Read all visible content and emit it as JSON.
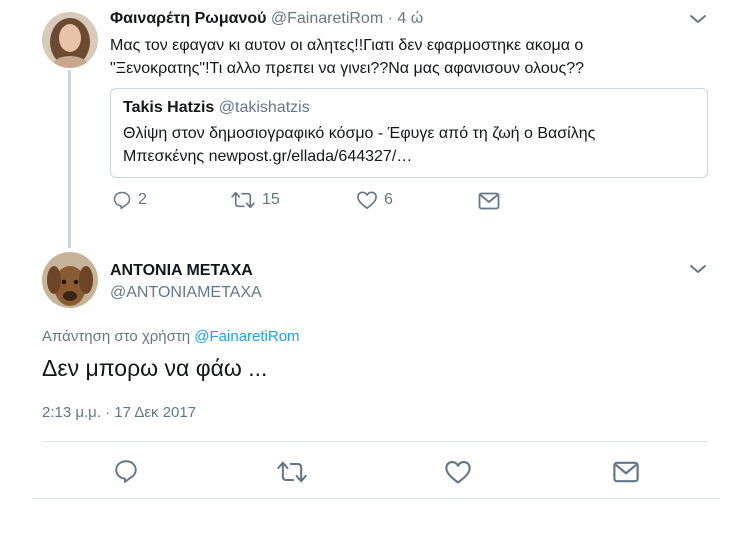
{
  "tweet": {
    "author_name": "Φαιναρέτη Ρωμανού",
    "author_handle": "@FainaretiRom",
    "separator": "·",
    "time_ago": "4 ώ",
    "text_line1": "Μας τον εφαγαν κι αυτον οι αλητες!!Γιατι δεν εφαρμοστηκε ακομα ο",
    "text_line2": "\"Ξενοκρατης\"!Τι αλλο πρεπει να γινει??Να μας αφανισουν ολους??",
    "quote": {
      "author_name": "Takis Hatzis",
      "author_handle": "@takishatzis",
      "text_line1": "Θλίψη στον δημοσιογραφικό κόσμο - Έφυγε από τη ζωή ο Βασίλης",
      "text_line2": "Μπεσκένης newpost.gr/ellada/644327/…"
    },
    "actions": {
      "reply_count": "2",
      "retweet_count": "15",
      "like_count": "6"
    }
  },
  "reply": {
    "author_name": "ANTONIA METAXA",
    "author_handle": "@ANTONIAMETAXA",
    "replying_to_label": "Απάντηση στο χρήστη",
    "replying_to_handle": "@FainaretiRom",
    "text": "Δεν μπορω να φάω ...",
    "timestamp": "2:13 μ.μ. · 17 Δεκ 2017"
  },
  "colors": {
    "link": "#1da1f2",
    "muted": "#657786",
    "border": "#e1e8ed"
  },
  "icons": [
    "chevron-down-icon",
    "reply-icon",
    "retweet-icon",
    "like-icon",
    "message-icon"
  ]
}
